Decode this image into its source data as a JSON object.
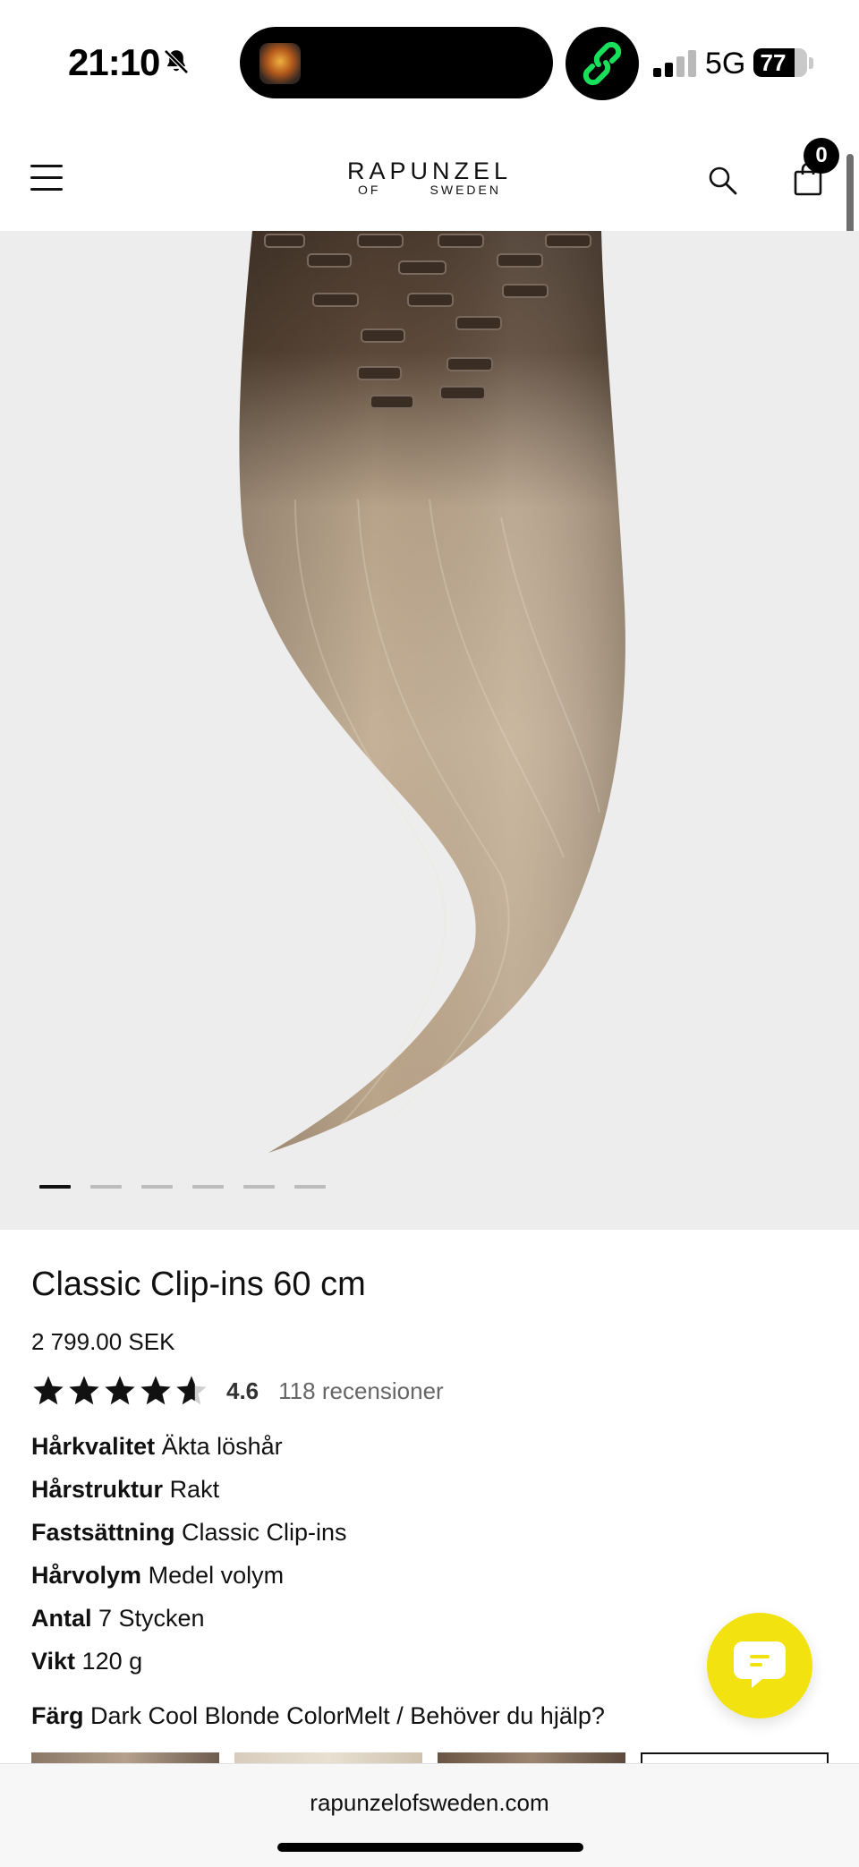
{
  "status_bar": {
    "time": "21:10",
    "network": "5G",
    "battery": "77",
    "battery_level": 0.77
  },
  "header": {
    "logo_main": "RAPUNZEL",
    "logo_of": "OF",
    "logo_sweden": "SWEDEN",
    "cart_count": "0"
  },
  "gallery": {
    "slide_count": 6,
    "active_slide": 1
  },
  "product": {
    "title": "Classic Clip-ins 60 cm",
    "price": "2 799.00 SEK",
    "rating": "4.6",
    "rating_value": 4.6,
    "reviews": "118 recensioner",
    "attributes": [
      {
        "label": "Hårkvalitet",
        "value": "Äkta löshår"
      },
      {
        "label": "Hårstruktur",
        "value": "Rakt"
      },
      {
        "label": "Fastsättning",
        "value": "Classic Clip-ins"
      },
      {
        "label": "Hårvolym",
        "value": "Medel volym"
      },
      {
        "label": "Antal",
        "value": "7 Stycken"
      },
      {
        "label": "Vikt",
        "value": "120 g"
      }
    ],
    "color_label": "Färg",
    "color_value": "Dark Cool Blonde ColorMelt",
    "help_link": "Behöver du hjälp?"
  },
  "colors": {
    "chat_yellow": "#f2e20f",
    "status_green": "#19e05a"
  },
  "browser": {
    "url": "rapunzelofsweden.com"
  }
}
